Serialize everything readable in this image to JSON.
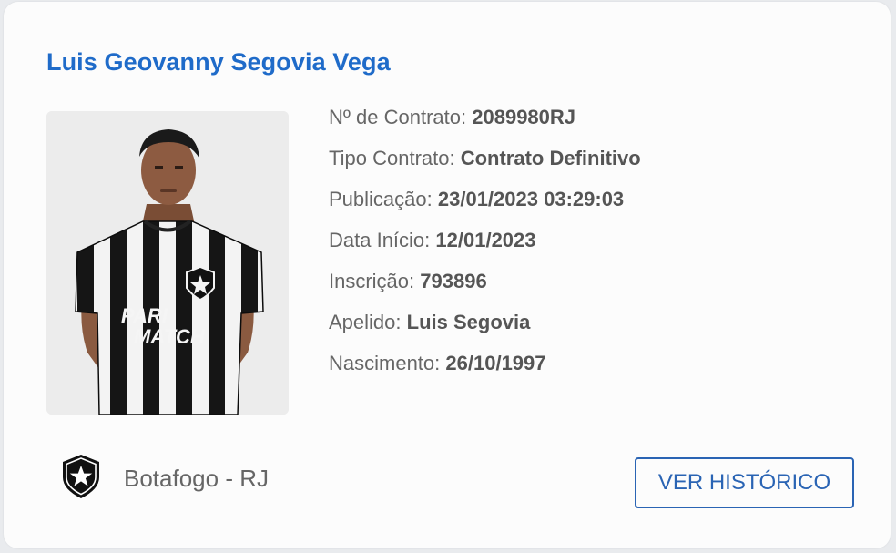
{
  "player": {
    "name": "Luis Geovanny Segovia Vega"
  },
  "photo": {
    "sponsor_line1": "PARI",
    "sponsor_line2": "MATCH"
  },
  "details": [
    {
      "label": "Nº de Contrato:",
      "value": "2089980RJ"
    },
    {
      "label": "Tipo Contrato:",
      "value": "Contrato Definitivo"
    },
    {
      "label": "Publicação:",
      "value": "23/01/2023 03:29:03"
    },
    {
      "label": "Data Início:",
      "value": "12/01/2023"
    },
    {
      "label": "Inscrição:",
      "value": "793896"
    },
    {
      "label": "Apelido:",
      "value": "Luis Segovia"
    },
    {
      "label": "Nascimento:",
      "value": "26/10/1997"
    }
  ],
  "club": {
    "name": "Botafogo - RJ",
    "icon": "botafogo-crest-icon"
  },
  "actions": {
    "history_button": "VER HISTÓRICO"
  },
  "colors": {
    "title": "#1f6bc9",
    "button": "#2a64b4",
    "text": "#666666"
  }
}
